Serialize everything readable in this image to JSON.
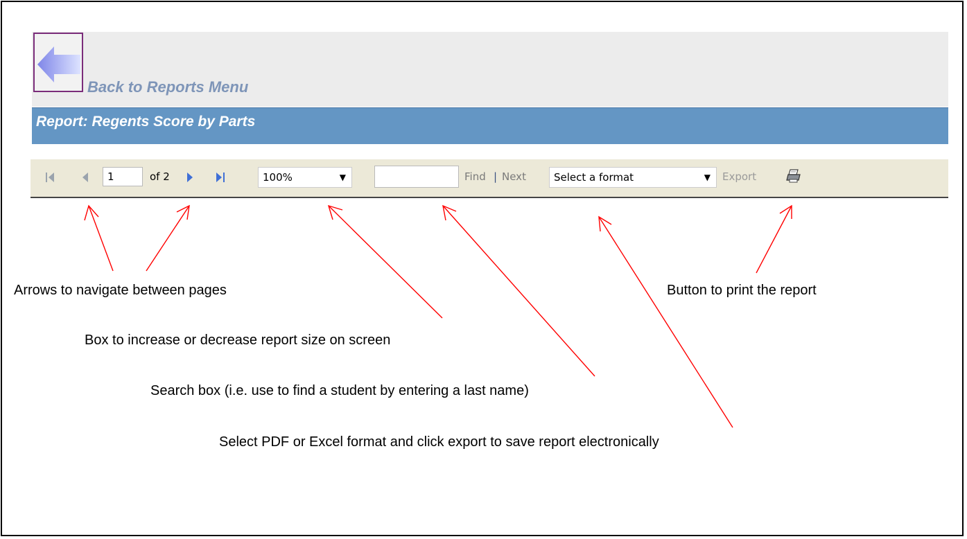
{
  "back": {
    "label": "Back to Reports Menu"
  },
  "report": {
    "title": "Report: Regents Score by Parts"
  },
  "toolbar": {
    "page_current": "1",
    "page_of": "of 2",
    "zoom": "100%",
    "search_value": "",
    "find_label": "Find",
    "separator": "|",
    "next_label": "Next",
    "format": "Select a format",
    "export_label": "Export",
    "icons": [
      "first-page-icon",
      "previous-page-icon",
      "next-page-icon",
      "last-page-icon",
      "printer-icon"
    ]
  },
  "annotations": {
    "nav_note": "Arrows to navigate between pages",
    "zoom_note": "Box to increase or decrease report size on screen",
    "search_note": "Search box (i.e. use to find a student by entering a last name)",
    "export_note": "Select PDF or Excel format and click export to save report electronically",
    "print_note": "Button to print the report"
  },
  "colors": {
    "title_bar": "#6496c4",
    "toolbar_bg": "#ece9d8",
    "back_label": "#7e95b8",
    "arrow": "#ff0000"
  }
}
